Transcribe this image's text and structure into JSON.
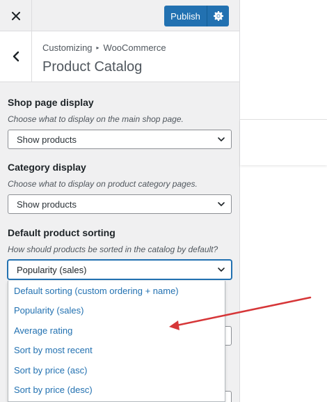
{
  "topbar": {
    "close_icon": "close-icon",
    "publish_label": "Publish",
    "settings_icon": "gear-icon"
  },
  "section": {
    "breadcrumb_parent": "Customizing",
    "breadcrumb_child": "WooCommerce",
    "title": "Product Catalog"
  },
  "controls": {
    "shop_page": {
      "label": "Shop page display",
      "description": "Choose what to display on the main shop page.",
      "value": "Show products"
    },
    "category": {
      "label": "Category display",
      "description": "Choose what to display on product category pages.",
      "value": "Show products"
    },
    "sorting": {
      "label": "Default product sorting",
      "description": "How should products be sorted in the catalog by default?",
      "value": "Popularity (sales)",
      "options": [
        "Default sorting (custom ordering + name)",
        "Popularity (sales)",
        "Average rating",
        "Sort by most recent",
        "Sort by price (asc)",
        "Sort by price (desc)"
      ]
    }
  },
  "colors": {
    "accent": "#2271b1",
    "annotation_arrow": "#d63638"
  }
}
